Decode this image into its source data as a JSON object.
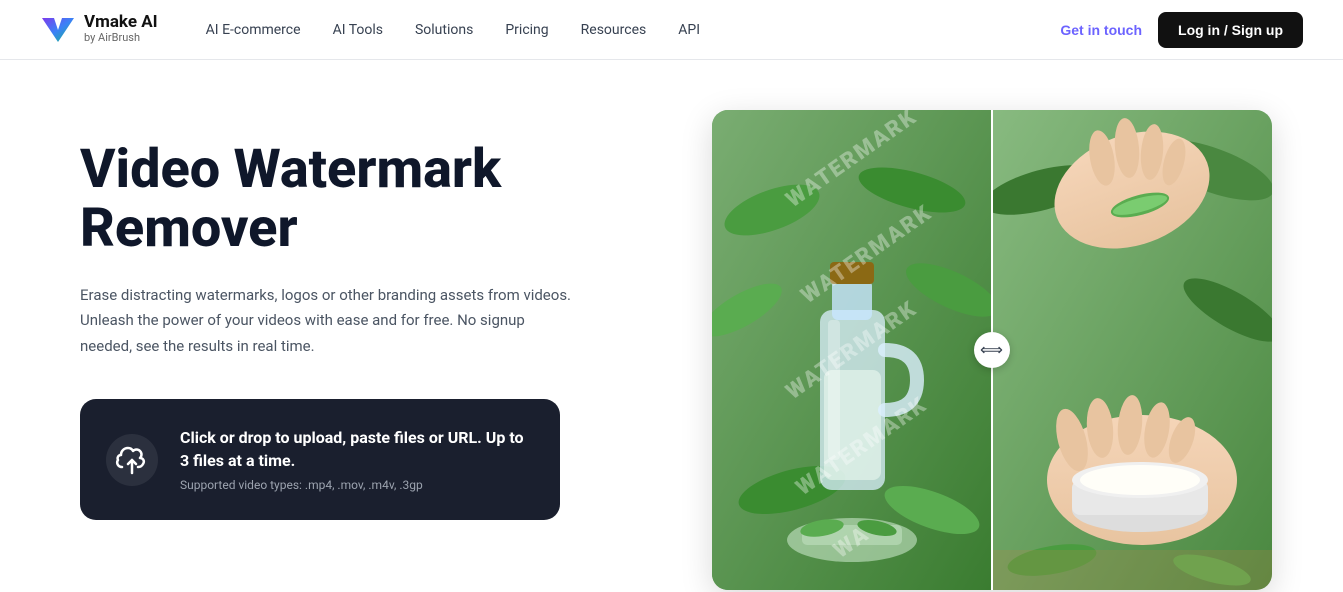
{
  "nav": {
    "logo_title": "Vmake AI",
    "logo_sub": "by AirBrush",
    "links": [
      {
        "label": "AI E-commerce",
        "id": "ai-ecommerce"
      },
      {
        "label": "AI Tools",
        "id": "ai-tools"
      },
      {
        "label": "Solutions",
        "id": "solutions"
      },
      {
        "label": "Pricing",
        "id": "pricing"
      },
      {
        "label": "Resources",
        "id": "resources"
      },
      {
        "label": "API",
        "id": "api"
      }
    ],
    "get_touch": "Get in touch",
    "login": "Log in / Sign up"
  },
  "hero": {
    "title": "Video Watermark Remover",
    "description": "Erase distracting watermarks, logos or other branding assets from videos. Unleash the power of your videos with ease and for free. No signup needed, see the results in real time.",
    "upload_main": "Click or drop to upload, paste files or URL. Up to 3 files at a time.",
    "upload_sub": "Supported video types: .mp4, .mov, .m4v, .3gp"
  },
  "comparison": {
    "watermarks": [
      "WATERMARK",
      "WATERMARK",
      "WATERMARK",
      "WATERMARK",
      "WA"
    ]
  }
}
